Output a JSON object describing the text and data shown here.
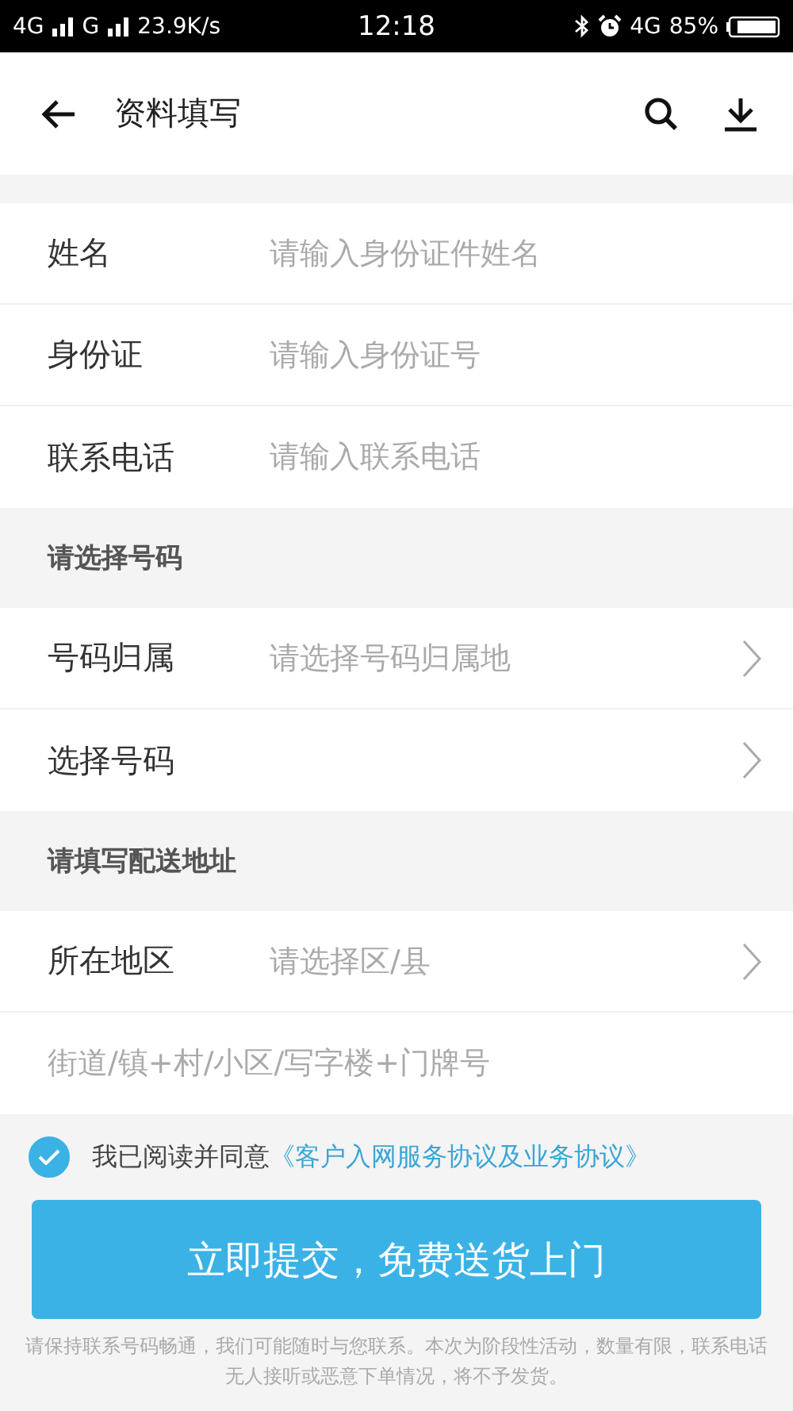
{
  "status_bar": {
    "network_1": "4G",
    "network_2": "G",
    "speed": "23.9K/s",
    "time": "12:18",
    "network_3": "4G",
    "battery": "85%"
  },
  "header": {
    "title": "资料填写"
  },
  "sections": [
    {
      "fields": [
        {
          "kind": "input",
          "label": "姓名",
          "placeholder": "请输入身份证件姓名"
        },
        {
          "kind": "input",
          "label": "身份证",
          "placeholder": "请输入身份证号"
        },
        {
          "kind": "input",
          "label": "联系电话",
          "placeholder": "请输入联系电话"
        }
      ]
    },
    {
      "heading": "请选择号码",
      "fields": [
        {
          "kind": "select",
          "label": "号码归属",
          "placeholder": "请选择号码归属地"
        },
        {
          "kind": "select",
          "label": "选择号码"
        }
      ]
    },
    {
      "heading": "请填写配送地址",
      "fields": [
        {
          "kind": "select",
          "label": "所在地区",
          "placeholder": "请选择区/县"
        },
        {
          "kind": "input",
          "placeholder": "街道/镇+村/小区/写字楼+门牌号"
        }
      ]
    }
  ],
  "agreement": {
    "checked": true,
    "text": "我已阅读并同意",
    "link": "《客户入网服务协议及业务协议》"
  },
  "submit": "立即提交，免费送货上门",
  "notice": "请保持联系号码畅通，我们可能随时与您联系。本次为阶段性活动，数量有限，联系电话无人接听或恶意下单情况，将不予发货。"
}
